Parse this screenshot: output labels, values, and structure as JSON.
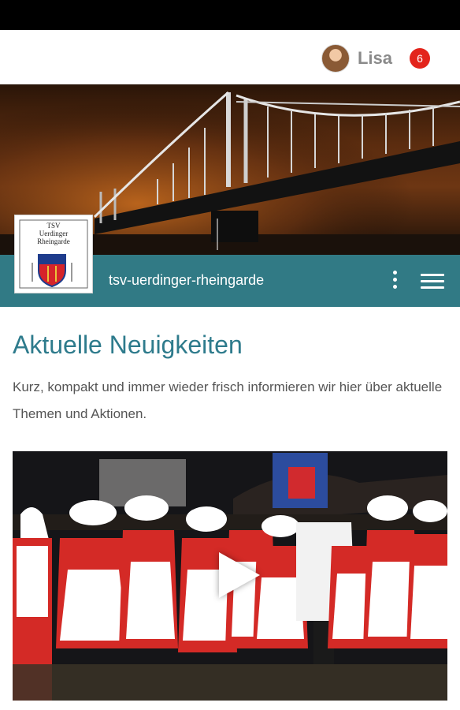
{
  "user": {
    "name": "Lisa",
    "notifications": "6"
  },
  "site": {
    "slug": "tsv-uerdinger-rheingarde"
  },
  "logo": {
    "line1": "TSV",
    "line2": "Uerdinger",
    "line3": "Rheingarde"
  },
  "content": {
    "title": "Aktuelle Neuigkeiten",
    "intro": "Kurz, kompakt und immer wieder frisch informieren wir hier über aktuelle Themen und Aktionen."
  },
  "colors": {
    "accent": "#317a85",
    "heading": "#2e7b8c",
    "badge": "#e3241b"
  },
  "icons": [
    "user-avatar",
    "notification-badge",
    "more-vert-icon",
    "menu-icon",
    "play-icon"
  ]
}
